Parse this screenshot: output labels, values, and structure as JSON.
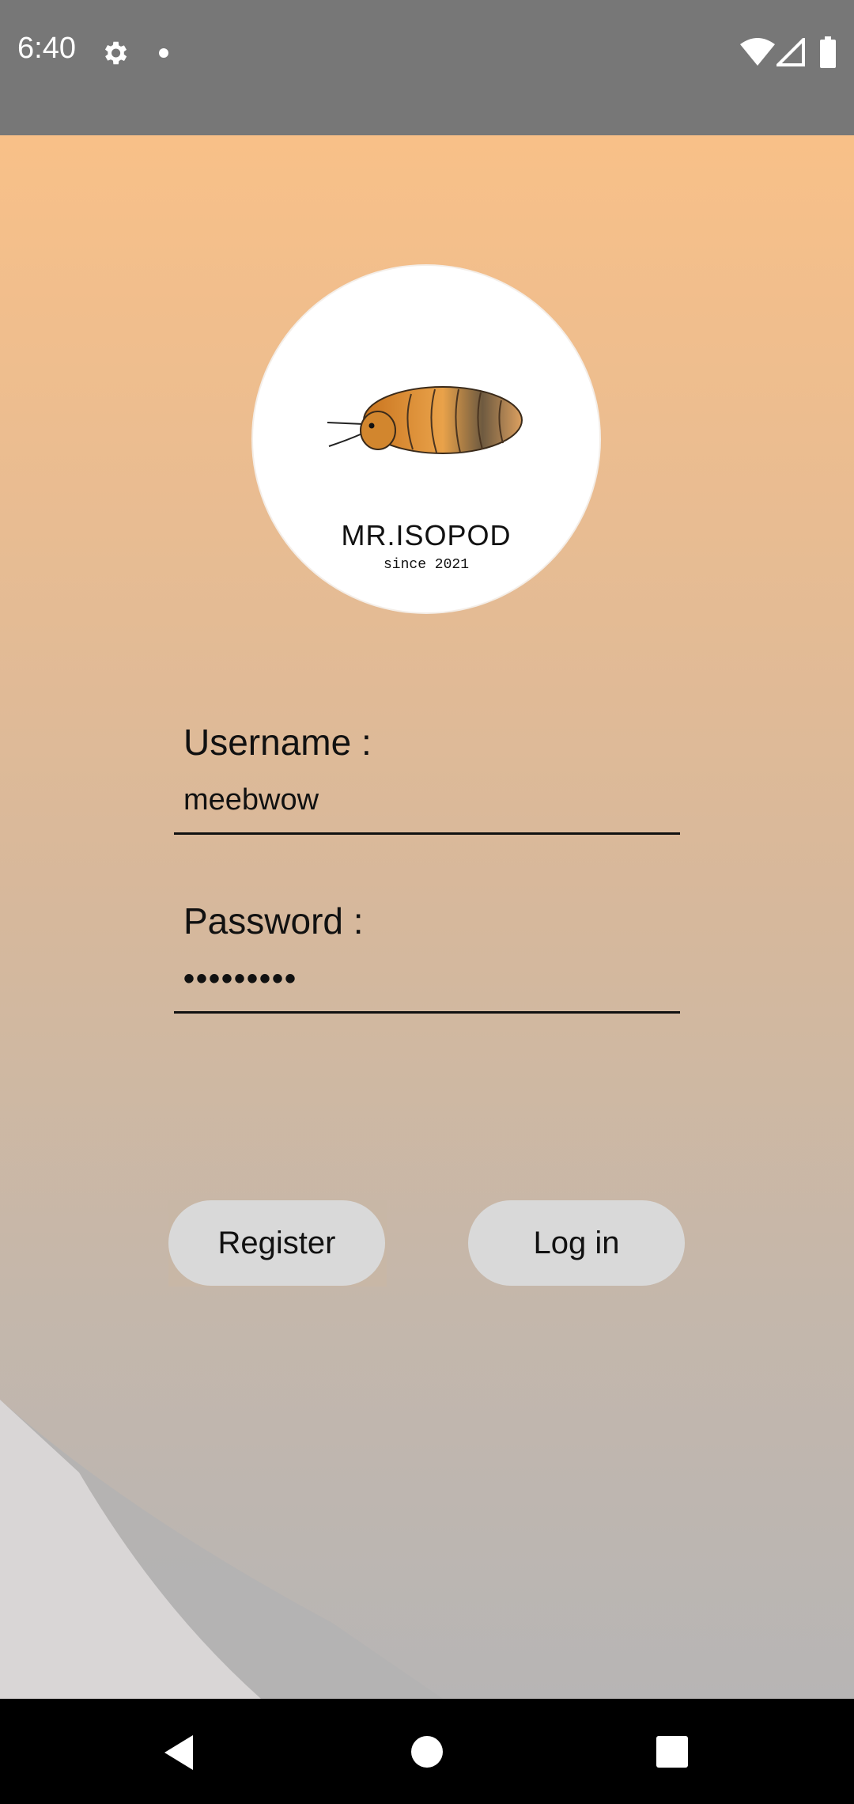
{
  "status_bar": {
    "time": "6:40",
    "icons": [
      "gear-icon",
      "notification-dot-icon",
      "wifi-icon",
      "signal-icon",
      "battery-icon"
    ],
    "background": "#777777"
  },
  "logo": {
    "brand": "MR.ISOPOD",
    "tagline": "since 2021"
  },
  "login_form": {
    "username_label": "Username :",
    "username_value": "meebwow",
    "password_label": "Password :",
    "password_value": "•••••••••",
    "register_button": "Register",
    "login_button": "Log in"
  },
  "nav_bar": {
    "icons": [
      "back-icon",
      "home-icon",
      "recents-icon"
    ]
  },
  "colors": {
    "gradient_top": "#f8c088",
    "gradient_bottom": "#b7b5b5",
    "button": "#d9d9d9"
  }
}
